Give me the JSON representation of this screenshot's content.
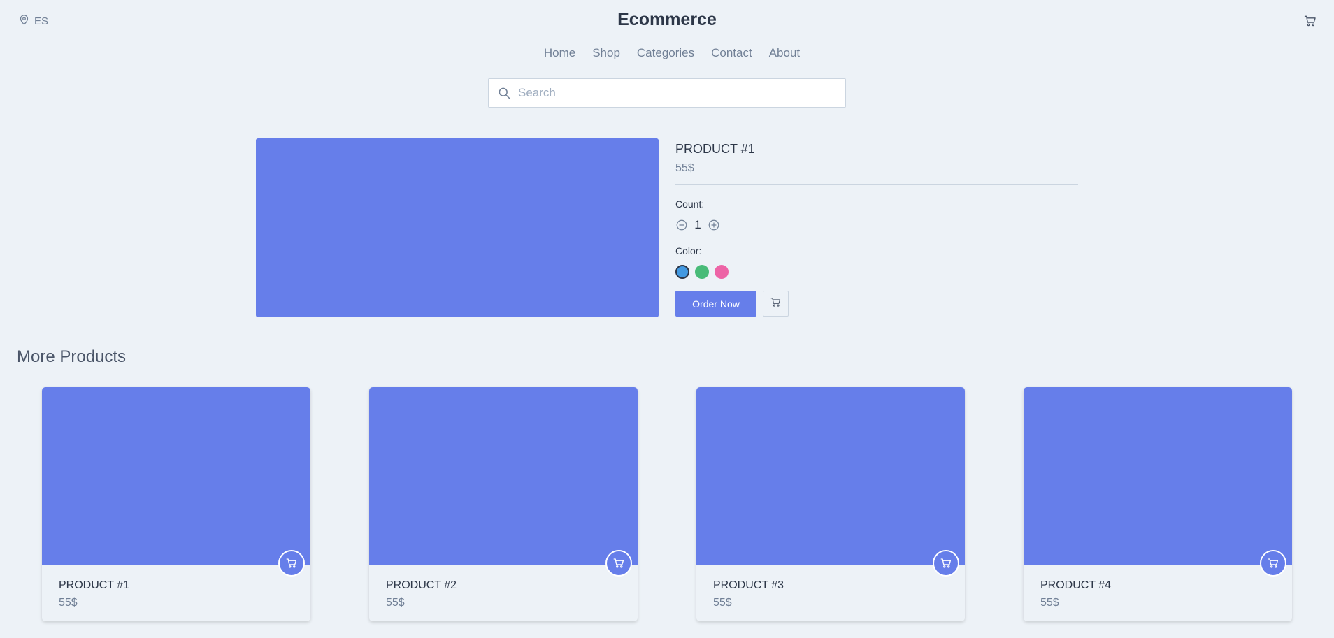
{
  "header": {
    "locale": "ES",
    "brand": "Ecommerce",
    "icons": {
      "location": "map-pin-icon",
      "cart": "cart-icon"
    }
  },
  "nav": {
    "items": [
      "Home",
      "Shop",
      "Categories",
      "Contact",
      "About"
    ]
  },
  "search": {
    "placeholder": "Search",
    "value": ""
  },
  "product": {
    "title": "PRODUCT #1",
    "price": "55$",
    "count_label": "Count:",
    "count": "1",
    "color_label": "Color:",
    "colors": [
      "#4299e1",
      "#48bb78",
      "#ed64a6"
    ],
    "selected_color": "#4299e1",
    "order_label": "Order Now"
  },
  "more": {
    "title": "More Products",
    "items": [
      {
        "name": "PRODUCT #1",
        "price": "55$"
      },
      {
        "name": "PRODUCT #2",
        "price": "55$"
      },
      {
        "name": "PRODUCT #3",
        "price": "55$"
      },
      {
        "name": "PRODUCT #4",
        "price": "55$"
      }
    ]
  },
  "theme": {
    "accent": "#667eea",
    "background": "#edf2f7",
    "text": "#2d3748",
    "muted": "#718096"
  }
}
